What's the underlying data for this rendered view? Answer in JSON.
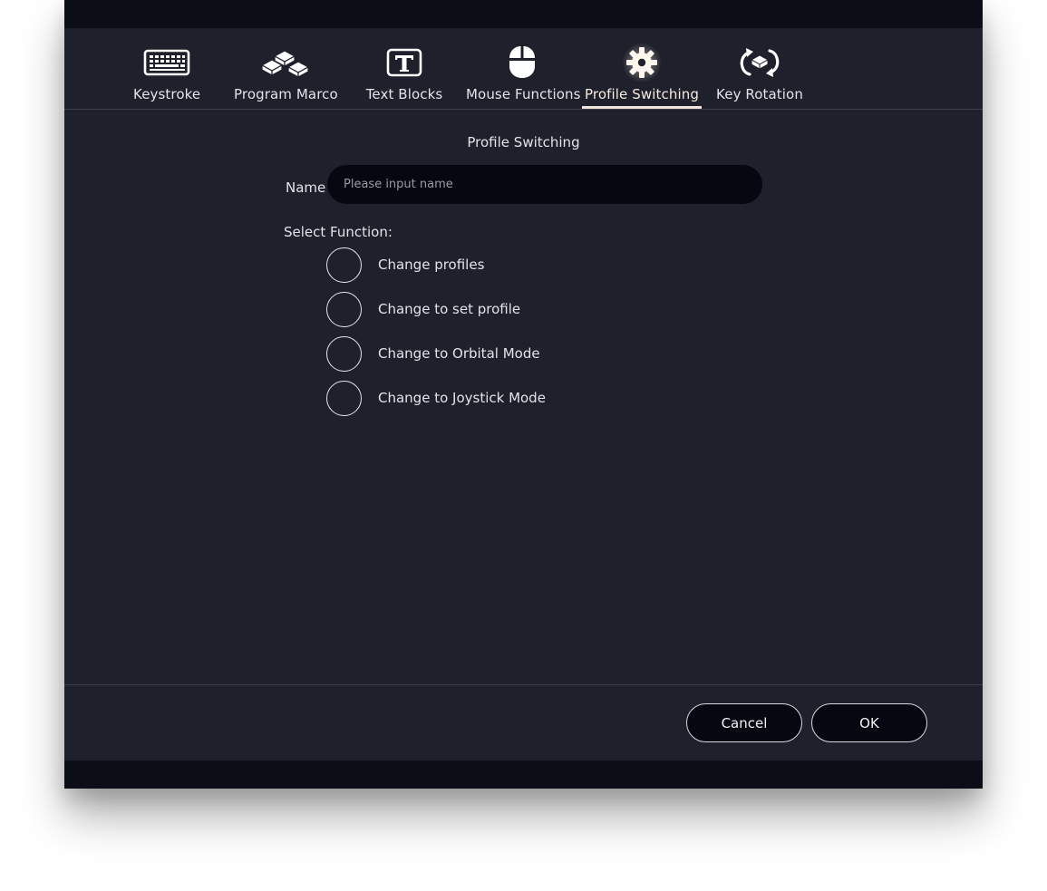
{
  "tabs": [
    {
      "label": "Keystroke",
      "icon": "keyboard-icon",
      "active": false
    },
    {
      "label": "Program Marco",
      "icon": "keycaps-icon",
      "active": false
    },
    {
      "label": "Text Blocks",
      "icon": "text-block-icon",
      "active": false
    },
    {
      "label": "Mouse Functions",
      "icon": "mouse-icon",
      "active": false
    },
    {
      "label": "Profile Switching",
      "icon": "gear-icon",
      "active": true
    },
    {
      "label": "Key Rotation",
      "icon": "rotate-key-icon",
      "active": false
    }
  ],
  "main": {
    "title": "Profile Switching",
    "name_label": "Name",
    "name_value": "",
    "name_placeholder": "Please input name",
    "select_label": "Select Function:",
    "options": [
      {
        "label": "Change profiles",
        "selected": false
      },
      {
        "label": "Change to set profile",
        "selected": false
      },
      {
        "label": "Change to Orbital Mode",
        "selected": false
      },
      {
        "label": "Change to Joystick Mode",
        "selected": false
      }
    ]
  },
  "footer": {
    "cancel_label": "Cancel",
    "ok_label": "OK"
  },
  "colors": {
    "panel_bg": "#1e202b",
    "strip_bg": "#0b0e17",
    "active_tab_underline": "#f2e6dc"
  }
}
